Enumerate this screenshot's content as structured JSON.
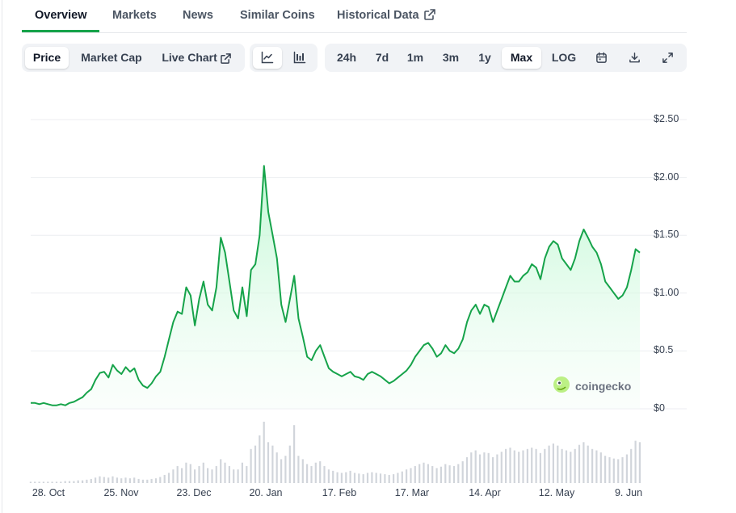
{
  "tabs": [
    {
      "label": "Overview"
    },
    {
      "label": "Markets"
    },
    {
      "label": "News"
    },
    {
      "label": "Similar Coins"
    },
    {
      "label": "Historical Data"
    }
  ],
  "toolbar": {
    "type_buttons": [
      {
        "label": "Price"
      },
      {
        "label": "Market Cap"
      },
      {
        "label": "Live Chart"
      }
    ],
    "ranges": [
      {
        "label": "24h"
      },
      {
        "label": "7d"
      },
      {
        "label": "1m"
      },
      {
        "label": "3m"
      },
      {
        "label": "1y"
      },
      {
        "label": "Max"
      },
      {
        "label": "LOG"
      }
    ],
    "active_type": "Price",
    "active_range": "Max",
    "active_view": "line"
  },
  "watermark": "coingecko",
  "colors": {
    "line": "#16a34a",
    "fill_top": "#bbf7d0",
    "volume": "#d1d5db",
    "active_tab": "#16a34a"
  },
  "chart_data": {
    "type": "line",
    "y_ticks": [
      "$2.50",
      "$2.00",
      "$1.50",
      "$1.00",
      "$0.5",
      "$0"
    ],
    "ylim": [
      0,
      2.5
    ],
    "x_ticks": [
      "28. Oct",
      "25. Nov",
      "23. Dec",
      "20. Jan",
      "17. Feb",
      "17. Mar",
      "14. Apr",
      "12. May",
      "9. Jun"
    ],
    "grid": true,
    "series": [
      {
        "values": [
          0.05,
          0.05,
          0.04,
          0.05,
          0.04,
          0.03,
          0.03,
          0.04,
          0.03,
          0.05,
          0.06,
          0.08,
          0.1,
          0.14,
          0.17,
          0.25,
          0.31,
          0.32,
          0.27,
          0.38,
          0.33,
          0.3,
          0.36,
          0.32,
          0.35,
          0.25,
          0.2,
          0.18,
          0.22,
          0.28,
          0.32,
          0.45,
          0.6,
          0.75,
          0.84,
          0.82,
          1.05,
          0.98,
          0.72,
          0.95,
          1.1,
          0.9,
          0.85,
          1.05,
          1.48,
          1.35,
          1.1,
          0.85,
          0.78,
          1.05,
          0.8,
          1.2,
          1.25,
          1.5,
          2.1,
          1.7,
          1.5,
          1.3,
          0.9,
          0.75,
          0.95,
          1.15,
          0.78,
          0.62,
          0.45,
          0.42,
          0.5,
          0.55,
          0.45,
          0.35,
          0.32,
          0.3,
          0.28,
          0.3,
          0.32,
          0.28,
          0.27,
          0.25,
          0.3,
          0.32,
          0.3,
          0.28,
          0.25,
          0.22,
          0.24,
          0.27,
          0.3,
          0.33,
          0.38,
          0.45,
          0.5,
          0.55,
          0.57,
          0.52,
          0.45,
          0.48,
          0.55,
          0.5,
          0.48,
          0.52,
          0.6,
          0.75,
          0.85,
          0.9,
          0.82,
          0.9,
          0.88,
          0.75,
          0.85,
          0.95,
          1.05,
          1.15,
          1.1,
          1.1,
          1.15,
          1.18,
          1.25,
          1.22,
          1.12,
          1.3,
          1.4,
          1.45,
          1.42,
          1.3,
          1.25,
          1.2,
          1.3,
          1.45,
          1.55,
          1.48,
          1.4,
          1.35,
          1.25,
          1.1,
          1.05,
          1.0,
          0.95,
          0.98,
          1.05,
          1.2,
          1.38,
          1.35
        ]
      },
      {
        "name": "Volume",
        "values": [
          0.02,
          0.02,
          0.02,
          0.02,
          0.02,
          0.02,
          0.02,
          0.02,
          0.03,
          0.03,
          0.03,
          0.04,
          0.04,
          0.05,
          0.06,
          0.08,
          0.1,
          0.09,
          0.08,
          0.1,
          0.08,
          0.07,
          0.08,
          0.07,
          0.08,
          0.06,
          0.05,
          0.05,
          0.06,
          0.07,
          0.09,
          0.12,
          0.15,
          0.2,
          0.25,
          0.22,
          0.3,
          0.28,
          0.2,
          0.25,
          0.3,
          0.22,
          0.2,
          0.25,
          0.35,
          0.3,
          0.25,
          0.2,
          0.2,
          0.3,
          0.25,
          0.5,
          0.55,
          0.7,
          0.9,
          0.6,
          0.55,
          0.45,
          0.35,
          0.4,
          0.55,
          0.85,
          0.4,
          0.35,
          0.28,
          0.25,
          0.3,
          0.32,
          0.25,
          0.2,
          0.18,
          0.16,
          0.15,
          0.16,
          0.18,
          0.15,
          0.14,
          0.13,
          0.15,
          0.16,
          0.15,
          0.14,
          0.13,
          0.12,
          0.13,
          0.15,
          0.17,
          0.2,
          0.22,
          0.25,
          0.28,
          0.3,
          0.28,
          0.25,
          0.22,
          0.24,
          0.28,
          0.26,
          0.25,
          0.28,
          0.32,
          0.38,
          0.45,
          0.48,
          0.42,
          0.45,
          0.44,
          0.38,
          0.42,
          0.46,
          0.5,
          0.52,
          0.48,
          0.46,
          0.48,
          0.5,
          0.52,
          0.5,
          0.44,
          0.5,
          0.55,
          0.58,
          0.55,
          0.5,
          0.48,
          0.46,
          0.5,
          0.56,
          0.6,
          0.55,
          0.5,
          0.48,
          0.45,
          0.4,
          0.38,
          0.36,
          0.35,
          0.38,
          0.42,
          0.5,
          0.62,
          0.6
        ]
      }
    ]
  }
}
